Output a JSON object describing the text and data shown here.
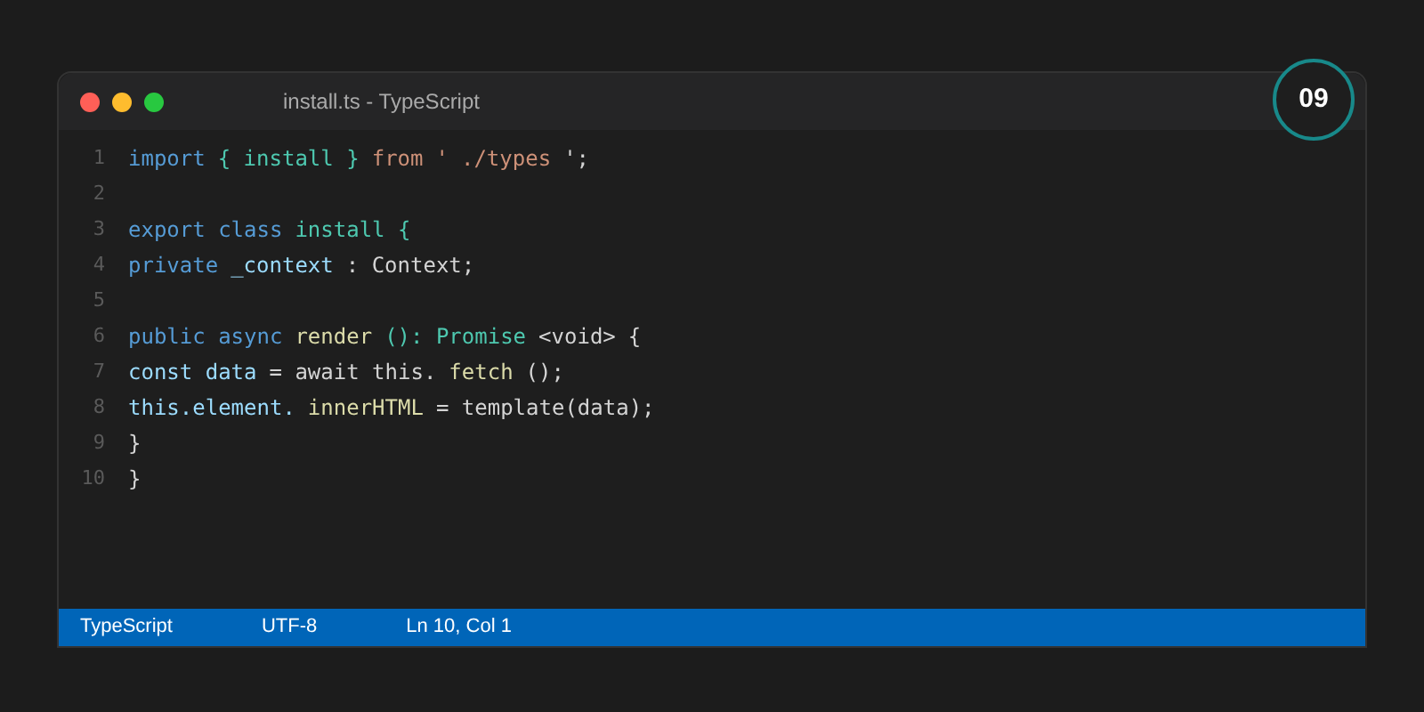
{
  "window": {
    "title": "install.ts - TypeScript"
  },
  "badge": "09",
  "code_lines": [
    {
      "number": "1",
      "tokens": [
        {
          "text": "import",
          "kind": "keyword"
        },
        {
          "text": "{ install }",
          "kind": "type"
        },
        {
          "text": "from",
          "kind": "string"
        },
        {
          "text": "'",
          "kind": "string"
        },
        {
          "text": "./types",
          "kind": "string"
        },
        {
          "text": "';",
          "kind": "plain"
        }
      ]
    },
    {
      "number": "2"
    },
    {
      "number": "3",
      "tokens": [
        {
          "text": "export class",
          "kind": "keyword"
        },
        {
          "text": "install {",
          "kind": "type"
        }
      ]
    },
    {
      "number": "4",
      "tokens": [
        {
          "text": "private",
          "kind": "keyword"
        },
        {
          "text": "_context",
          "kind": "variable"
        },
        {
          "text": ": Context;",
          "kind": "plain"
        }
      ]
    },
    {
      "number": "5"
    },
    {
      "number": "6",
      "tokens": [
        {
          "text": "public async",
          "kind": "keyword"
        },
        {
          "text": "render",
          "kind": "function"
        },
        {
          "text": "(): Promise",
          "kind": "type"
        },
        {
          "text": "<void>",
          "kind": "plain"
        },
        {
          "text": "{",
          "kind": "plain"
        }
      ]
    },
    {
      "number": "7",
      "tokens": [
        {
          "text": "const data",
          "kind": "variable"
        },
        {
          "text": "= await this.",
          "kind": "plain"
        },
        {
          "text": "fetch",
          "kind": "function"
        },
        {
          "text": "();",
          "kind": "plain"
        }
      ]
    },
    {
      "number": "8",
      "tokens": [
        {
          "text": "this.element.",
          "kind": "variable"
        },
        {
          "text": "innerHTML",
          "kind": "function"
        },
        {
          "text": "= template(data);",
          "kind": "plain"
        }
      ]
    },
    {
      "number": "9",
      "tokens": [
        {
          "text": "}",
          "kind": "plain"
        }
      ]
    },
    {
      "number": "10",
      "tokens": [
        {
          "text": "}",
          "kind": "plain"
        }
      ]
    }
  ],
  "status_bar": [
    "TypeScript",
    "UTF-8",
    "Ln 10, Col 1"
  ]
}
